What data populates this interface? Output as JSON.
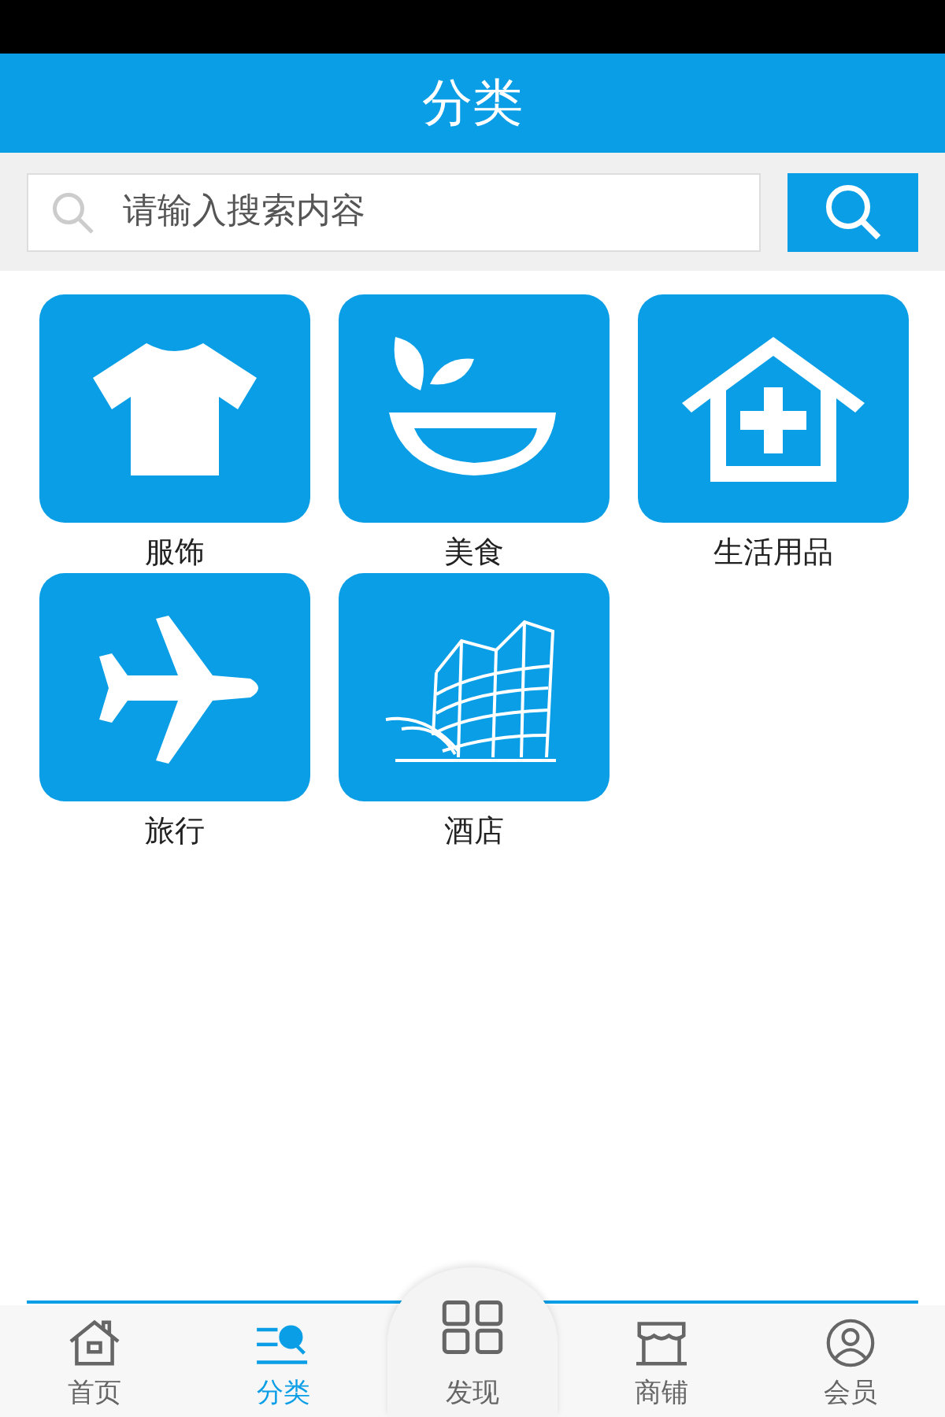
{
  "header": {
    "title": "分类"
  },
  "search": {
    "placeholder": "请输入搜索内容"
  },
  "categories": [
    {
      "label": "服饰",
      "kind": "shirt"
    },
    {
      "label": "美食",
      "kind": "bowl"
    },
    {
      "label": "生活用品",
      "kind": "house"
    },
    {
      "label": "旅行",
      "kind": "plane"
    },
    {
      "label": "酒店",
      "kind": "building"
    }
  ],
  "tab_bar": [
    {
      "label": "首页",
      "kind": "home",
      "selected": false
    },
    {
      "label": "分类",
      "kind": "category",
      "selected": true
    },
    {
      "label": "发现",
      "kind": "grid",
      "selected": false
    },
    {
      "label": "商铺",
      "kind": "shop",
      "selected": false
    },
    {
      "label": "会员",
      "kind": "user",
      "selected": false
    }
  ]
}
